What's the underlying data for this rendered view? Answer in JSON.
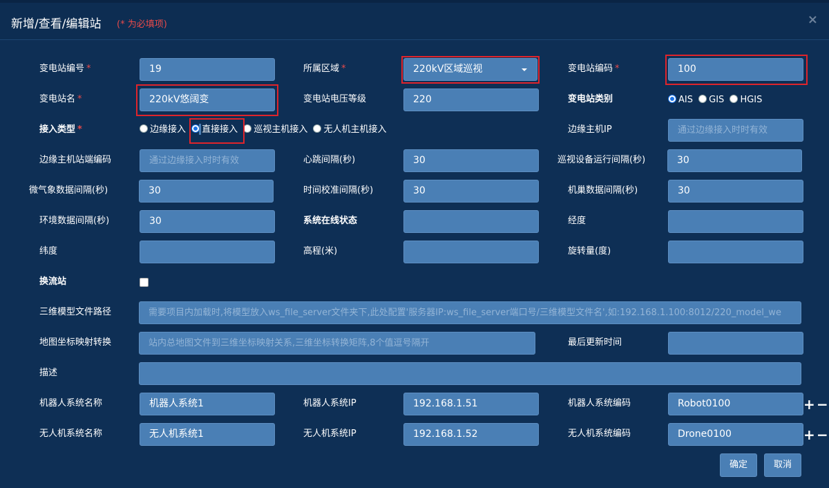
{
  "dialog": {
    "title": "新增/查看/编辑站",
    "required_note": "(* 为必填项)",
    "close_glyph": "×"
  },
  "fields": {
    "station_no": {
      "label": "变电站编号",
      "value": "19"
    },
    "area": {
      "label": "所属区域",
      "value": "220kV区域巡视"
    },
    "station_code": {
      "label": "变电站编码",
      "value": "100"
    },
    "station_name": {
      "label": "变电站名",
      "value": "220kV悠阔变"
    },
    "voltage_level": {
      "label": "变电站电压等级",
      "value": "220"
    },
    "station_type": {
      "label": "变电站类别",
      "options": [
        "AIS",
        "GIS",
        "HGIS"
      ],
      "selected": "AIS"
    },
    "access_type": {
      "label": "接入类型",
      "options": [
        "边缘接入",
        "直接接入",
        "巡视主机接入",
        "无人机主机接入"
      ],
      "selected": "直接接入"
    },
    "edge_host_ip": {
      "label": "边缘主机IP",
      "placeholder": "通过边缘接入时时有效"
    },
    "edge_host_code": {
      "label": "边缘主机站端编码",
      "placeholder": "通过边缘接入时时有效"
    },
    "heartbeat": {
      "label": "心跳间隔(秒)",
      "value": "30"
    },
    "patrol_interval": {
      "label": "巡视设备运行间隔(秒)",
      "value": "30"
    },
    "weather_interval": {
      "label": "微气象数据间隔(秒)",
      "value": "30"
    },
    "time_sync_interval": {
      "label": "时间校准间隔(秒)",
      "value": "30"
    },
    "cluster_interval": {
      "label": "机巢数据间隔(秒)",
      "value": "30"
    },
    "env_interval": {
      "label": "环境数据间隔(秒)",
      "value": "30"
    },
    "online_status": {
      "label": "系统在线状态",
      "value": ""
    },
    "longitude": {
      "label": "经度",
      "value": ""
    },
    "latitude": {
      "label": "纬度",
      "value": ""
    },
    "altitude": {
      "label": "高程(米)",
      "value": ""
    },
    "rotation": {
      "label": "旋转量(度)",
      "value": ""
    },
    "converter": {
      "label": "换流站",
      "checked": false
    },
    "model_path": {
      "label": "三维模型文件路径",
      "placeholder": "需要项目内加载时,将模型放入ws_file_server文件夹下,此处配置'服务器IP:ws_file_server端口号/三维模型文件名',如:192.168.1.100:8012/220_model_we"
    },
    "map_transform": {
      "label": "地图坐标映射转换",
      "placeholder": "站内总地图文件到三维坐标映射关系,三维坐标转换矩阵,8个值逗号隔开"
    },
    "last_update": {
      "label": "最后更新时间",
      "value": ""
    },
    "description": {
      "label": "描述",
      "value": ""
    },
    "robot_name": {
      "label": "机器人系统名称",
      "value": "机器人系统1"
    },
    "robot_ip": {
      "label": "机器人系统IP",
      "value": "192.168.1.51"
    },
    "robot_code": {
      "label": "机器人系统编码",
      "value": "Robot0100"
    },
    "uav_name": {
      "label": "无人机系统名称",
      "value": "无人机系统1"
    },
    "uav_ip": {
      "label": "无人机系统IP",
      "value": "192.168.1.52"
    },
    "uav_code": {
      "label": "无人机系统编码",
      "value": "Drone0100"
    }
  },
  "required_mark": "*",
  "row_actions": {
    "add": "+",
    "remove": "−"
  },
  "buttons": {
    "confirm": "确定",
    "cancel": "取消"
  },
  "colors": {
    "background": "#0e2f55",
    "input": "#4a7fb5",
    "highlight": "#e0242b",
    "required": "#e84a4a"
  }
}
